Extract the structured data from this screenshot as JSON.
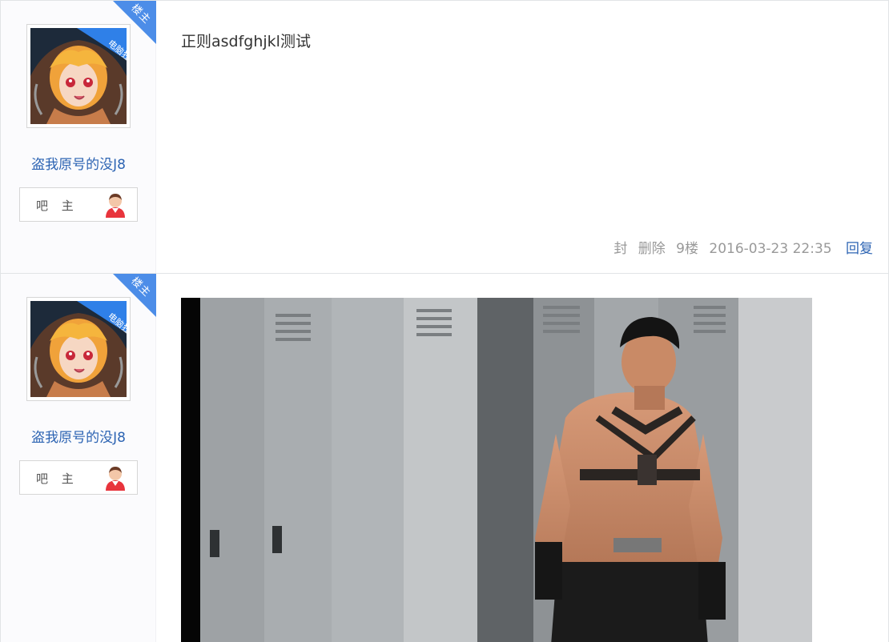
{
  "thread": {
    "posts": [
      {
        "louzhu_badge": "楼主",
        "author": {
          "name": "盗我原号的没J8",
          "avatar_icon": "anime-girl-avatar",
          "avatar_banner": "电脑狂人",
          "role": "吧 主",
          "role_icon": "user-red-icon"
        },
        "content": {
          "text": "正则asdfghjkl测试"
        },
        "tail": {
          "ban": "封",
          "delete": "删除",
          "floor": "9楼",
          "time": "2016-03-23 22:35",
          "reply": "回复"
        }
      },
      {
        "louzhu_badge": "楼主",
        "author": {
          "name": "盗我原号的没J8",
          "avatar_icon": "anime-girl-avatar",
          "avatar_banner": "电脑狂人",
          "role": "吧 主",
          "role_icon": "user-red-icon"
        },
        "content": {
          "image": "man-in-locker-room-photo"
        }
      }
    ]
  },
  "colors": {
    "link": "#2d64b3",
    "muted": "#999999",
    "ribbon": "#4c8de8",
    "sidebar_bg": "#fbfbfd"
  }
}
